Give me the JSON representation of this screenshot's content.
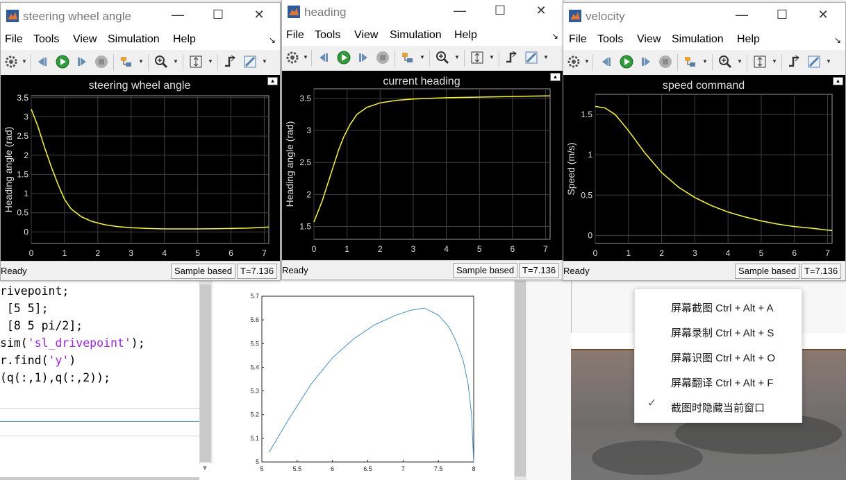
{
  "editor": {
    "lines": [
      {
        "pre": "rivepoint;",
        "str": "",
        "post": ""
      },
      {
        "pre": " [5 5];",
        "str": "",
        "post": ""
      },
      {
        "pre": " [8 5 pi/2];",
        "str": "",
        "post": ""
      },
      {
        "pre": "sim(",
        "str": "'sl_drivepoint'",
        "post": ");"
      },
      {
        "pre": "r.find(",
        "str": "'y'",
        "post": ")"
      },
      {
        "pre": "(q(:,1),q(:,2));",
        "str": "",
        "post": ""
      }
    ]
  },
  "windows": [
    {
      "title": "steering wheel angle",
      "menu": [
        "File",
        "Tools",
        "View",
        "Simulation",
        "Help"
      ],
      "plot_title": "steering wheel angle",
      "ylabel": "Heading angle (rad)",
      "status": {
        "ready": "Ready",
        "mode": "Sample based",
        "time": "T=7.136"
      }
    },
    {
      "title": "heading",
      "menu": [
        "File",
        "Tools",
        "View",
        "Simulation",
        "Help"
      ],
      "plot_title": "current heading",
      "ylabel": "Heading angle (rad)",
      "status": {
        "ready": "Ready",
        "mode": "Sample based",
        "time": "T=7.136"
      }
    },
    {
      "title": "velocity",
      "menu": [
        "File",
        "Tools",
        "View",
        "Simulation",
        "Help"
      ],
      "plot_title": "speed command",
      "ylabel": "Speed (m/s)",
      "status": {
        "ready": "Ready",
        "mode": "Sample based",
        "time": "T=7.136"
      }
    }
  ],
  "context_menu": {
    "items": [
      "屏幕截图 Ctrl + Alt + A",
      "屏幕录制 Ctrl + Alt + S",
      "屏幕识图 Ctrl + Alt + O",
      "屏幕翻译 Ctrl + Alt + F",
      "截图时隐藏当前窗口"
    ],
    "checked_index": 4
  },
  "colors": {
    "scope_bg": "#000000",
    "trace": "#ffff00",
    "grid": "#404040",
    "path": "#3d8fd1"
  },
  "chart_data": [
    {
      "type": "line",
      "title": "steering wheel angle",
      "ylabel": "Heading angle (rad)",
      "xlim": [
        0,
        7.136
      ],
      "ylim": [
        -0.3,
        3.55
      ],
      "xticks": [
        0,
        1,
        2,
        3,
        4,
        5,
        6,
        7
      ],
      "yticks": [
        0,
        0.5,
        1,
        1.5,
        2,
        2.5,
        3,
        3.5
      ],
      "grid": true,
      "x": [
        0,
        0.2,
        0.4,
        0.6,
        0.8,
        1.0,
        1.2,
        1.5,
        1.8,
        2.2,
        2.6,
        3.0,
        3.5,
        4.0,
        4.5,
        5.0,
        5.5,
        6.0,
        6.5,
        7.0,
        7.136
      ],
      "y": [
        3.2,
        2.75,
        2.2,
        1.7,
        1.25,
        0.85,
        0.6,
        0.4,
        0.28,
        0.19,
        0.14,
        0.11,
        0.09,
        0.08,
        0.08,
        0.08,
        0.085,
        0.09,
        0.1,
        0.12,
        0.13
      ]
    },
    {
      "type": "line",
      "title": "current heading",
      "ylabel": "Heading angle (rad)",
      "xlim": [
        0,
        7.136
      ],
      "ylim": [
        1.3,
        3.65
      ],
      "xticks": [
        0,
        1,
        2,
        3,
        4,
        5,
        6,
        7
      ],
      "yticks": [
        1.5,
        2,
        2.5,
        3,
        3.5
      ],
      "grid": true,
      "x": [
        0,
        0.25,
        0.5,
        0.75,
        0.9,
        1.1,
        1.3,
        1.6,
        2.0,
        2.5,
        3.0,
        4.0,
        5.0,
        6.0,
        7.0,
        7.136
      ],
      "y": [
        1.57,
        1.9,
        2.3,
        2.7,
        2.9,
        3.1,
        3.25,
        3.36,
        3.43,
        3.47,
        3.49,
        3.51,
        3.52,
        3.53,
        3.54,
        3.54
      ]
    },
    {
      "type": "line",
      "title": "speed command",
      "ylabel": "Speed (m/s)",
      "xlim": [
        0,
        7.136
      ],
      "ylim": [
        -0.1,
        1.75
      ],
      "xticks": [
        0,
        1,
        2,
        3,
        4,
        5,
        6,
        7
      ],
      "yticks": [
        0,
        0.5,
        1,
        1.5
      ],
      "grid": true,
      "x": [
        0,
        0.3,
        0.6,
        1.0,
        1.5,
        2.0,
        2.5,
        3.0,
        3.5,
        4.0,
        4.5,
        5.0,
        5.5,
        6.0,
        6.5,
        7.0,
        7.136
      ],
      "y": [
        1.6,
        1.58,
        1.5,
        1.3,
        1.02,
        0.78,
        0.6,
        0.47,
        0.37,
        0.29,
        0.23,
        0.18,
        0.14,
        0.11,
        0.09,
        0.065,
        0.06
      ]
    },
    {
      "type": "line",
      "title": "",
      "xlim": [
        5,
        8
      ],
      "ylim": [
        5,
        5.7
      ],
      "xticks": [
        5,
        5.5,
        6,
        6.5,
        7,
        7.5,
        8
      ],
      "yticks": [
        5,
        5.1,
        5.2,
        5.3,
        5.4,
        5.5,
        5.6,
        5.7
      ],
      "grid": false,
      "x": [
        5.1,
        5.4,
        5.7,
        6.0,
        6.3,
        6.6,
        6.9,
        7.1,
        7.3,
        7.5,
        7.65,
        7.75,
        7.85,
        7.92,
        7.97,
        8.0
      ],
      "y": [
        5.04,
        5.19,
        5.33,
        5.44,
        5.52,
        5.58,
        5.62,
        5.64,
        5.65,
        5.62,
        5.57,
        5.51,
        5.43,
        5.33,
        5.2,
        5.0
      ]
    }
  ]
}
